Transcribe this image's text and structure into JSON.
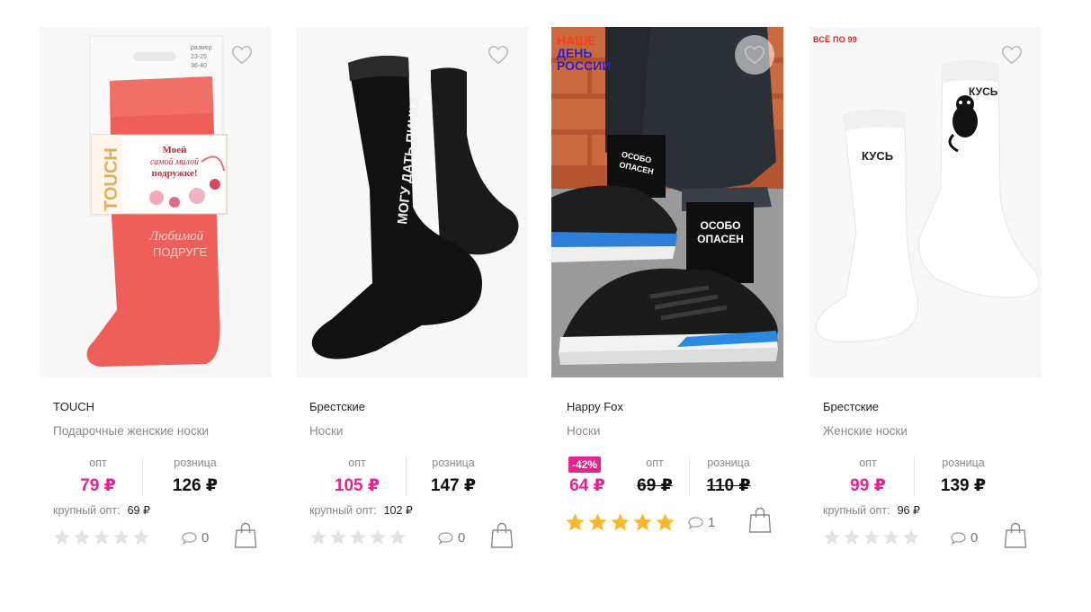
{
  "colors": {
    "accent_pink": "#e8218c",
    "star_gold": "#f5b82e",
    "star_empty": "#e3e3e3"
  },
  "icons": {
    "favorite": "heart-outline-icon",
    "comments": "comment-bubble-icon",
    "cart": "shopping-bag-icon",
    "rating": "star-icon"
  },
  "products": [
    {
      "brand": "TOUCH",
      "name": "Подарочные женские носки",
      "opt_label": "опт",
      "retail_label": "розница",
      "opt_price": "79 ₽",
      "retail_price": "126 ₽",
      "bulk_label": "крупный опт:",
      "bulk_price": "69 ₽",
      "rating": 0,
      "comments": "0",
      "package": {
        "size_title": "размер",
        "size_1": "23-25",
        "size_2": "36-40",
        "card_brand": "TOUCH",
        "card_l1": "Моей",
        "card_l2": "самой милой",
        "card_l3": "подружке!",
        "knit_l1": "Любимой",
        "knit_l2": "ПОДРУГЕ"
      }
    },
    {
      "brand": "Брестские",
      "name": "Носки",
      "opt_label": "опт",
      "retail_label": "розница",
      "opt_price": "105 ₽",
      "retail_price": "147 ₽",
      "bulk_label": "крупный опт:",
      "bulk_price": "102 ₽",
      "rating": 0,
      "comments": "0",
      "sock_text": "МОГУ ДАТЬ ПИНКА"
    },
    {
      "brand": "Happy Fox",
      "name": "Носки",
      "promo_l1": "НАШЕ",
      "promo_l2": "ДЕНЬ",
      "promo_l3": "РОССИИ",
      "discount": "-42%",
      "opt_label": "опт",
      "retail_label": "розница",
      "price_now": "64 ₽",
      "opt_price_old": "69 ₽",
      "retail_price_old": "110 ₽",
      "rating": 5,
      "comments": "1",
      "sock_text_1": "ОСОБО",
      "sock_text_2": "ОПАСЕН"
    },
    {
      "brand": "Брестские",
      "name": "Женские носки",
      "promo": "ВСЁ ПО 99",
      "opt_label": "опт",
      "retail_label": "розница",
      "opt_price": "99 ₽",
      "retail_price": "139 ₽",
      "bulk_label": "крупный опт:",
      "bulk_price": "96 ₽",
      "rating": 0,
      "comments": "0",
      "sock_text": "КУСЬ"
    }
  ]
}
